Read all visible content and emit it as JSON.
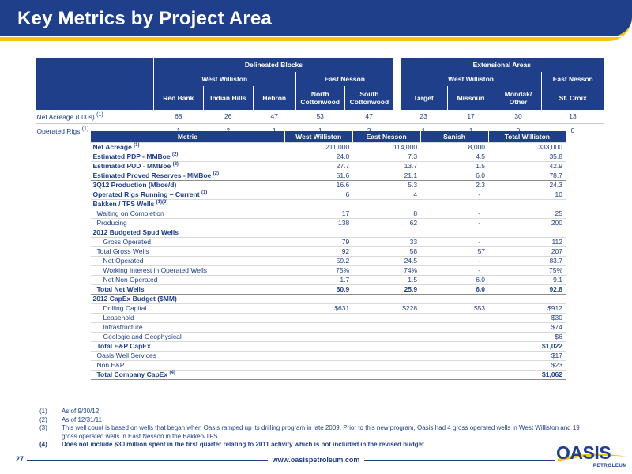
{
  "title": "Key Metrics by Project Area",
  "top_table": {
    "group1": "Delineated Blocks",
    "group2": "Extensional Areas",
    "sub": [
      "West Williston",
      "East Nesson",
      "West Williston",
      "East Nesson"
    ],
    "cols": [
      "Red Bank",
      "Indian Hills",
      "Hebron",
      "North Cottonwood",
      "South Cottonwood",
      "Target",
      "Missouri",
      "Mondak/ Other",
      "St. Croix"
    ],
    "rows": [
      {
        "label": "Net Acreage (000s)",
        "sup": "(1)",
        "values": [
          "68",
          "26",
          "47",
          "53",
          "47",
          "23",
          "17",
          "30",
          "13"
        ]
      },
      {
        "label": "Operated Rigs",
        "sup": "(1)",
        "values": [
          "1",
          "2",
          "1",
          "1",
          "3",
          "1",
          "1",
          "0",
          "0"
        ]
      }
    ]
  },
  "metrics": {
    "headers": [
      "Metric",
      "West Williston",
      "East Nesson",
      "Sanish",
      "Total Williston"
    ],
    "rows": [
      {
        "label": "Net Acreage",
        "sup": "(1)",
        "v": [
          "211,000",
          "114,000",
          "8,000",
          "333,000"
        ]
      },
      {
        "label": "Estimated PDP - MMBoe",
        "sup": "(2)",
        "v": [
          "24.0",
          "7.3",
          "4.5",
          "35.8"
        ]
      },
      {
        "label": "Estimated PUD - MMBoe",
        "sup": "(2)",
        "v": [
          "27.7",
          "13.7",
          "1.5",
          "42.9"
        ]
      },
      {
        "label": "Estimated Proved Reserves - MMBoe",
        "sup": "(2)",
        "v": [
          "51.6",
          "21.1",
          "6.0",
          "78.7"
        ]
      },
      {
        "label": "3Q12 Production (Mboe/d)",
        "sup": "",
        "v": [
          "16.6",
          "5.3",
          "2.3",
          "24.3"
        ]
      },
      {
        "label": "Operated Rigs Running – Current",
        "sup": "(1)",
        "v": [
          "6",
          "4",
          "-",
          "10"
        ]
      },
      {
        "label": "Bakken / TFS Wells",
        "sup": "(1)(3)",
        "v": [
          "",
          "",
          "",
          ""
        ]
      },
      {
        "label": "Waiting on Completion",
        "sup": "",
        "v": [
          "17",
          "8",
          "-",
          "25"
        ]
      },
      {
        "label": "Producing",
        "sup": "",
        "v": [
          "138",
          "62",
          "-",
          "200"
        ]
      },
      {
        "label": "2012 Budgeted Spud Wells",
        "sup": "",
        "v": [
          "",
          "",
          "",
          ""
        ]
      },
      {
        "label": "Gross Operated",
        "sup": "",
        "v": [
          "79",
          "33",
          "-",
          "112"
        ]
      },
      {
        "label": "Total Gross Wells",
        "sup": "",
        "v": [
          "92",
          "58",
          "57",
          "207"
        ]
      },
      {
        "label": "Net Operated",
        "sup": "",
        "v": [
          "59.2",
          "24.5",
          "-",
          "83.7"
        ]
      },
      {
        "label": "Working Interest in Operated Wells",
        "sup": "",
        "v": [
          "75%",
          "74%",
          "-",
          "75%"
        ]
      },
      {
        "label": "Net Non Operated",
        "sup": "",
        "v": [
          "1.7",
          "1.5",
          "6.0",
          "9.1"
        ]
      },
      {
        "label": "Total Net Wells",
        "sup": "",
        "v": [
          "60.9",
          "25.9",
          "6.0",
          "92.8"
        ]
      },
      {
        "label": "2012 CapEx Budget ($MM)",
        "sup": "",
        "v": [
          "",
          "",
          "",
          ""
        ]
      },
      {
        "label": "Drilling Capital",
        "sup": "",
        "v": [
          "$631",
          "$228",
          "$53",
          "$912"
        ]
      },
      {
        "label": "Leasehold",
        "sup": "",
        "v": [
          "",
          "",
          "",
          "$30"
        ]
      },
      {
        "label": "Infrastructure",
        "sup": "",
        "v": [
          "",
          "",
          "",
          "$74"
        ]
      },
      {
        "label": "Geologic and Geophysical",
        "sup": "",
        "v": [
          "",
          "",
          "",
          "$6"
        ]
      },
      {
        "label": "Total E&P CapEx",
        "sup": "",
        "v": [
          "",
          "",
          "",
          "$1,022"
        ]
      },
      {
        "label": "Oasis Well Services",
        "sup": "",
        "v": [
          "",
          "",
          "",
          "$17"
        ]
      },
      {
        "label": "Non E&P",
        "sup": "",
        "v": [
          "",
          "",
          "",
          "$23"
        ]
      },
      {
        "label": "Total Company CapEx",
        "sup": "(4)",
        "v": [
          "",
          "",
          "",
          "$1,062"
        ]
      }
    ]
  },
  "footnotes": [
    {
      "n": "(1)",
      "text": "As of 9/30/12"
    },
    {
      "n": "(2)",
      "text": "As of 12/31/11"
    },
    {
      "n": "(3)",
      "text": "This well count is based on wells that began when Oasis ramped up its drilling program in late 2009.  Prior to this new program, Oasis had 4 gross operated wells in West Williston and  19 gross operated wells in  East Nesson in the Bakken/TFS."
    },
    {
      "n": "(4)",
      "text": "Does not include $30 million spent in the first quarter relating to 2011 activity which is not included in the revised budget"
    }
  ],
  "footer": {
    "page": "27",
    "url": "www.oasispetroleum.com",
    "logo": "OASIS",
    "logo_sub": "PETROLEUM"
  },
  "colors": {
    "navy": "#1f3f8a",
    "gold": "#f0c419"
  }
}
